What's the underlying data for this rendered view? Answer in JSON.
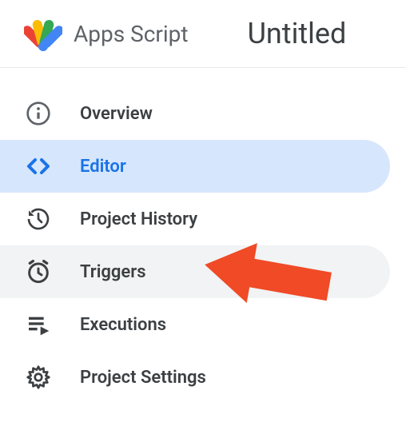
{
  "header": {
    "app_title": "Apps Script",
    "project_name": "Untitled"
  },
  "sidebar": {
    "items": [
      {
        "label": "Overview",
        "icon": "info"
      },
      {
        "label": "Editor",
        "icon": "code"
      },
      {
        "label": "Project History",
        "icon": "history"
      },
      {
        "label": "Triggers",
        "icon": "alarm"
      },
      {
        "label": "Executions",
        "icon": "playlist"
      },
      {
        "label": "Project Settings",
        "icon": "gear"
      }
    ]
  },
  "colors": {
    "active_bg": "#d6e6fd",
    "active_text": "#1a73e8",
    "hover_bg": "#f1f3f4",
    "text": "#3c4043",
    "muted": "#5f6368",
    "annotation": "#f04a26"
  }
}
